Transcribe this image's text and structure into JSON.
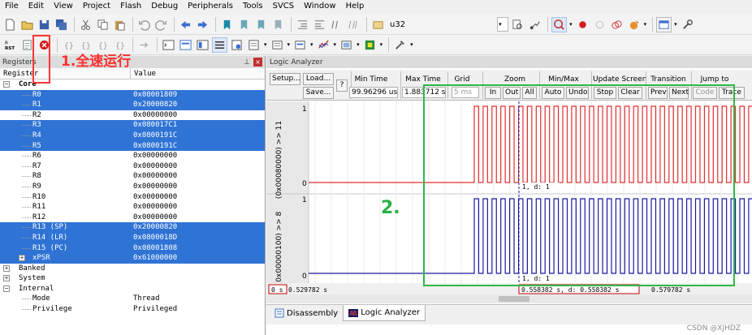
{
  "menu": [
    "File",
    "Edit",
    "View",
    "Project",
    "Flash",
    "Debug",
    "Peripherals",
    "Tools",
    "SVCS",
    "Window",
    "Help"
  ],
  "toolbar": {
    "target_text": "u32"
  },
  "registers": {
    "title": "Registers",
    "col_register": "Register",
    "col_value": "Value",
    "rows": [
      {
        "name": "Core",
        "value": "",
        "level": 0,
        "expand": "−",
        "bold": true,
        "sel": false
      },
      {
        "name": "R0",
        "value": "0x08001809",
        "level": 2,
        "sel": true
      },
      {
        "name": "R1",
        "value": "0x20000820",
        "level": 2,
        "sel": true
      },
      {
        "name": "R2",
        "value": "0x00000000",
        "level": 2,
        "sel": false
      },
      {
        "name": "R3",
        "value": "0x080017C1",
        "level": 2,
        "sel": true
      },
      {
        "name": "R4",
        "value": "0x0800191C",
        "level": 2,
        "sel": true
      },
      {
        "name": "R5",
        "value": "0x0800191C",
        "level": 2,
        "sel": true
      },
      {
        "name": "R6",
        "value": "0x00000000",
        "level": 2,
        "sel": false
      },
      {
        "name": "R7",
        "value": "0x00000000",
        "level": 2,
        "sel": false
      },
      {
        "name": "R8",
        "value": "0x00000000",
        "level": 2,
        "sel": false
      },
      {
        "name": "R9",
        "value": "0x00000000",
        "level": 2,
        "sel": false
      },
      {
        "name": "R10",
        "value": "0x00000000",
        "level": 2,
        "sel": false
      },
      {
        "name": "R11",
        "value": "0x00000000",
        "level": 2,
        "sel": false
      },
      {
        "name": "R12",
        "value": "0x00000000",
        "level": 2,
        "sel": false
      },
      {
        "name": "R13 (SP)",
        "value": "0x20000820",
        "level": 2,
        "sel": true
      },
      {
        "name": "R14 (LR)",
        "value": "0x0800018D",
        "level": 2,
        "sel": true
      },
      {
        "name": "R15 (PC)",
        "value": "0x08001808",
        "level": 2,
        "sel": true
      },
      {
        "name": "xPSR",
        "value": "0x61000000",
        "level": 2,
        "expand": "+",
        "sel": true
      },
      {
        "name": "Banked",
        "value": "",
        "level": 0,
        "expand": "+",
        "sel": false
      },
      {
        "name": "System",
        "value": "",
        "level": 0,
        "expand": "+",
        "sel": false
      },
      {
        "name": "Internal",
        "value": "",
        "level": 0,
        "expand": "−",
        "sel": false
      },
      {
        "name": "Mode",
        "value": "Thread",
        "level": 2,
        "sel": false
      },
      {
        "name": "Privilege",
        "value": "Privileged",
        "level": 2,
        "sel": false
      }
    ]
  },
  "logic_analyzer": {
    "title": "Logic Analyzer",
    "setup": "Setup...",
    "load": "Load...",
    "save": "Save...",
    "help": "?",
    "min_time_label": "Min Time",
    "min_time": "99.96296 us",
    "max_time_label": "Max Time",
    "max_time": "1.883712 s",
    "grid_label": "Grid",
    "grid": "5 ms",
    "zoom_label": "Zoom",
    "zoom_in": "In",
    "zoom_out": "Out",
    "zoom_all": "All",
    "minmax_label": "Min/Max",
    "auto": "Auto",
    "undo": "Undo",
    "update_label": "Update Screen",
    "stop": "Stop",
    "clear": "Clear",
    "transition_label": "Transition",
    "prev": "Prev",
    "next": "Next",
    "jump_label": "Jump to",
    "code": "Code",
    "trace": "Trace",
    "signal1": "(0x00080000) >> 11",
    "signal2": "(0x00000100) >> 8",
    "one": "1",
    "zero": "0",
    "cursor_label_top": "1,  d: 1",
    "cursor_label_bottom": "1,  d: 1",
    "t_start": "0 s",
    "t_left": "0.529782 s",
    "t_cursor": "0.558382 s,   d: 0.558382 s",
    "t_right": "0.579782 s"
  },
  "tabs": {
    "disassembly": "Disassembly",
    "logic_analyzer": "Logic Analyzer"
  },
  "annotations": {
    "step1": "1.全速运行",
    "step2": "2."
  },
  "watermark": "CSDN @XJHDZ",
  "colors": {
    "selection": "#2f73d5",
    "signal_red": "#e03030",
    "signal_blue": "#1a1aa0",
    "annot_red": "#ff3030",
    "annot_green": "#2fb84a"
  }
}
